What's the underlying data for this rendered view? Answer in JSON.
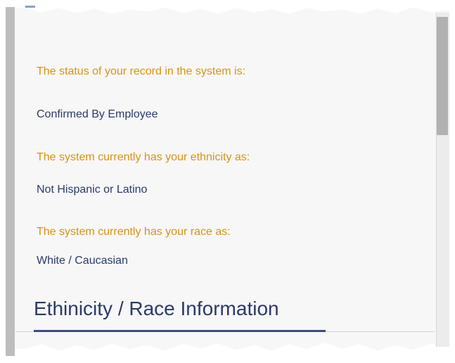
{
  "record": {
    "status_label": "The status of your record in the system is:",
    "status_value": "Confirmed By Employee",
    "ethnicity_label": "The system currently has your ethnicity as:",
    "ethnicity_value": "Not Hispanic or Latino",
    "race_label": "The system currently has your race as:",
    "race_value": "White / Caucasian"
  },
  "section": {
    "title": "Ethinicity / Race Information"
  },
  "colors": {
    "label": "#d4941b",
    "value": "#2b3a67",
    "underline": "#3c4c7c"
  }
}
